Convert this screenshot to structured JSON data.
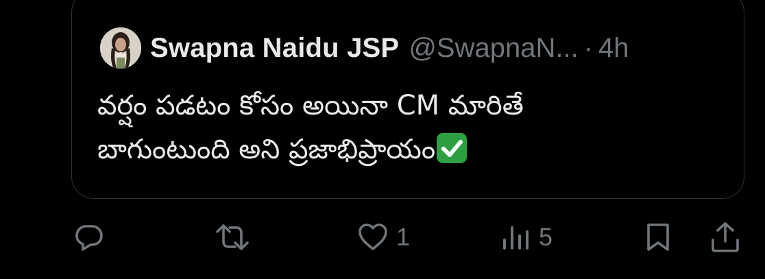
{
  "quoted_tweet": {
    "display_name": "Swapna Naidu JSP",
    "handle": "@SwapnaN...",
    "separator": "·",
    "time": "4h",
    "text_lines": [
      "వర్షం పడటం కోసం అయినా CM మారితే",
      "బాగుంటుంది అని ప్రజాభిప్రాయం"
    ],
    "trailing_emoji": "check-mark-emoji"
  },
  "actions": {
    "reply": {
      "icon": "reply-icon"
    },
    "retweet": {
      "icon": "retweet-icon"
    },
    "like": {
      "icon": "heart-icon",
      "count": "1"
    },
    "views": {
      "icon": "views-icon",
      "count": "5"
    },
    "bookmark": {
      "icon": "bookmark-icon"
    },
    "share": {
      "icon": "share-icon"
    }
  },
  "colors": {
    "background": "#000000",
    "text": "#e7e9ea",
    "muted": "#71767b",
    "border": "#2f3336",
    "check_emoji": "#2ea043"
  }
}
